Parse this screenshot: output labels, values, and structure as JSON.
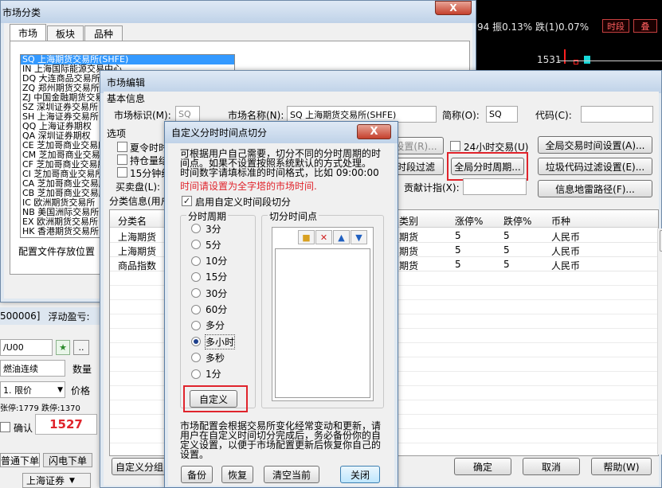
{
  "colors": {
    "accent_red": "#e0242c",
    "up_red": "#ff2020",
    "cyan": "#18d8d8",
    "blue_link": "#1d3f8c"
  },
  "bg": {
    "ticker": "94 振0.13% 跌(1)0.07%",
    "ticker_btn1": "时段",
    "ticker_btn2": "叠",
    "price": "1531",
    "left_frag1": "500006]",
    "left_frag2": "浮动盈亏:",
    "code_input": "/U00",
    "combo1": "燃油连续",
    "qty": "数量",
    "limit": "1. 限价",
    "price_lbl": "价格",
    "limits_line": "张停:1779 跌停:1370",
    "confirm": "确认",
    "big_price": "1527",
    "tab1": "普通下单",
    "tab2": "闪电下单",
    "broker": "上海证券"
  },
  "cat_win": {
    "title": "市场分类",
    "tabs": [
      "市场",
      "板块",
      "品种"
    ],
    "items": [
      "SQ 上海期货交易所(SHFE)",
      "IN 上海国际能源交易中心",
      "DQ 大连商品交易所",
      "ZQ 郑州期货交易所",
      "ZJ 中国金融期货交易所",
      "SZ 深圳证券交易所",
      "SH 上海证券交易所",
      "QQ 上海证券期权",
      "QA 深圳证券期权",
      "CE 芝加哥商业交易所",
      "CM 芝加哥商业交易所",
      "CF 芝加哥商业交易所",
      "CI 芝加哥商业交易所",
      "CA 芝加哥商业交易所",
      "CB 芝加哥商业交易所",
      "IC 欧洲期货交易所",
      "NB 美国洲际交易所",
      "EX 欧洲期货交易所",
      "HK 香港期货交易所"
    ],
    "config_lbl": "配置文件存放位置"
  },
  "edit_win": {
    "title": "市场编辑",
    "basic": "基本信息",
    "mid_lbl": "市场标识(M):",
    "mid_val": "SQ",
    "mname_lbl": "市场名称(N):",
    "mname_val": "SQ 上海期货交易所(SHFE)",
    "short_lbl": "简称(O):",
    "short_val": "SQ",
    "code_lbl": "代码(C):",
    "options": "选项",
    "opt1": "夏令时时",
    "opt2": "持仓量结",
    "opt3": "15分钟线",
    "opt4": "买卖盘(L):",
    "set_r": "设置(R)...",
    "chk24": "24小时交易(U)",
    "btn_global_time": "全局交易时间设置(A)...",
    "btn_period_filter": "时段过滤",
    "btn_global_period": "全局分时周期...",
    "btn_junk": "垃圾代码过滤设置(E)...",
    "contrib": "贡献计指(X):",
    "btn_mine": "信息地雷路径(F)...",
    "cat_info": "分类信息(用户",
    "cols": [
      "分类名",
      "类别",
      "涨停%",
      "跌停%",
      "币种"
    ],
    "rows": [
      {
        "name": "上海期货",
        "type": "期货",
        "up": "5",
        "down": "5",
        "cur": "人民币"
      },
      {
        "name": "上海期货",
        "type": "期货",
        "up": "5",
        "down": "5",
        "cur": "人民币"
      },
      {
        "name": "商品指数",
        "type": "期货",
        "up": "5",
        "down": "5",
        "cur": "人民币"
      }
    ],
    "btn_custom_group": "自定义分组",
    "btn_ok": "确定",
    "btn_cancel": "取消",
    "btn_help": "帮助(W)"
  },
  "dialog": {
    "title": "自定义分时时间点切分",
    "close": "X",
    "desc1": "可根据用户自己需要，切分不同的分时周期的时",
    "desc2": "间点。如果不设置按照系统默认的方式处理。",
    "desc3": "时间数字请填标准的时间格式，比如 09:00:00",
    "warn": "时间请设置为全字塔的市场时间.",
    "enable": "启用自定义时间段切分",
    "period_grp": "分时周期",
    "split_grp": "切分时间点",
    "periods": [
      "3分",
      "5分",
      "10分",
      "15分",
      "30分",
      "60分",
      "多分",
      "多小时",
      "多秒",
      "1分"
    ],
    "selected": "多小时",
    "btn_custom": "自定义",
    "note1": "市场配置会根据交易所变化经常变动和更新，请",
    "note2": "用户在自定义时间切分完成后，务必备份你的自",
    "note3": "定义设置，以便于市场配置更新后恢复你自己的",
    "note4": "设置。",
    "btn_backup": "备份",
    "btn_restore": "恢复",
    "btn_clear": "清空当前",
    "btn_close": "关闭"
  }
}
